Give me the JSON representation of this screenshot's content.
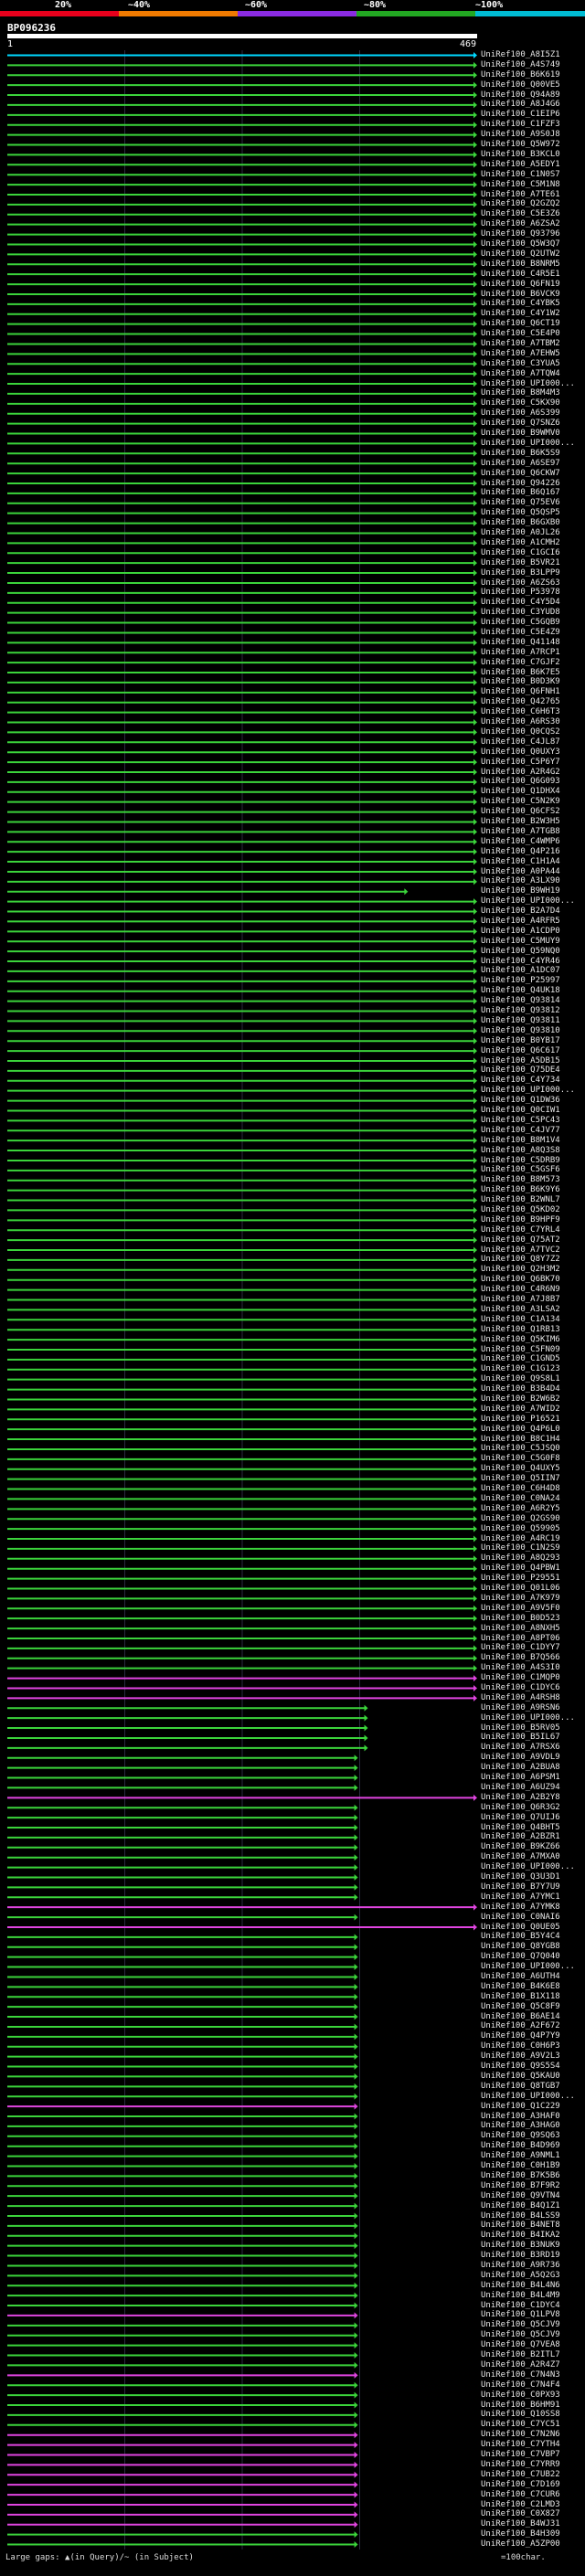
{
  "query": {
    "name": "BP096236",
    "coord_start": "1",
    "coord_end": "469",
    "length": 469
  },
  "scale": {
    "labels": [
      "20%",
      "~40%",
      "~60%",
      "~80%",
      "~100%"
    ],
    "colors": [
      "#e8001c",
      "#f07a00",
      "#8a2be2",
      "#22a722",
      "#00bcd4"
    ]
  },
  "footer": {
    "text": "Large gaps: ▲(in Query)/~ (in Subject)",
    "legend": "=100char."
  },
  "chart_data": {
    "type": "alignment-overview",
    "x_range": [
      1,
      469
    ],
    "hits": [
      {
        "id": "UniRef100_A8I5Z1",
        "end": 469,
        "color": "cyan"
      },
      {
        "id": "UniRef100_A4S749",
        "end": 469
      },
      {
        "id": "UniRef100_B6K619",
        "end": 469
      },
      {
        "id": "UniRef100_Q00VE5",
        "end": 469
      },
      {
        "id": "UniRef100_Q94A89",
        "end": 469
      },
      {
        "id": "UniRef100_A8J4G6",
        "end": 469
      },
      {
        "id": "UniRef100_C1EIP6",
        "end": 469
      },
      {
        "id": "UniRef100_C1FZF3",
        "end": 469
      },
      {
        "id": "UniRef100_A9S0J8",
        "end": 469
      },
      {
        "id": "UniRef100_Q5W972",
        "end": 469
      },
      {
        "id": "UniRef100_B3KCL0",
        "end": 469
      },
      {
        "id": "UniRef100_A5EDY1",
        "end": 469
      },
      {
        "id": "UniRef100_C1N0S7",
        "end": 469
      },
      {
        "id": "UniRef100_C5M1N8",
        "end": 469
      },
      {
        "id": "UniRef100_A7TE61",
        "end": 469
      },
      {
        "id": "UniRef100_Q2GZQ2",
        "end": 469
      },
      {
        "id": "UniRef100_C5E3Z6",
        "end": 469
      },
      {
        "id": "UniRef100_A6ZSA2",
        "end": 469
      },
      {
        "id": "UniRef100_Q93796",
        "end": 469
      },
      {
        "id": "UniRef100_Q5W3Q7",
        "end": 469
      },
      {
        "id": "UniRef100_Q2UTW2",
        "end": 469
      },
      {
        "id": "UniRef100_B8NRM5",
        "end": 469
      },
      {
        "id": "UniRef100_C4R5E1",
        "end": 469
      },
      {
        "id": "UniRef100_Q6FN19",
        "end": 469
      },
      {
        "id": "UniRef100_B6VCK9",
        "end": 469
      },
      {
        "id": "UniRef100_C4YBK5",
        "end": 469
      },
      {
        "id": "UniRef100_C4Y1W2",
        "end": 469
      },
      {
        "id": "UniRef100_Q6CT19",
        "end": 469
      },
      {
        "id": "UniRef100_C5E4P0",
        "end": 469
      },
      {
        "id": "UniRef100_A7TBM2",
        "end": 469
      },
      {
        "id": "UniRef100_A7EHW5",
        "end": 469
      },
      {
        "id": "UniRef100_C3YUA5",
        "end": 469
      },
      {
        "id": "UniRef100_A7TQW4",
        "end": 469
      },
      {
        "id": "UniRef100_UPI000...",
        "end": 469
      },
      {
        "id": "UniRef100_B8M4M3",
        "end": 469
      },
      {
        "id": "UniRef100_C5KX90",
        "end": 469
      },
      {
        "id": "UniRef100_A6S399",
        "end": 469
      },
      {
        "id": "UniRef100_Q7SNZ6",
        "end": 469
      },
      {
        "id": "UniRef100_B9WMV0",
        "end": 469
      },
      {
        "id": "UniRef100_UPI000...",
        "end": 469
      },
      {
        "id": "UniRef100_B6K5S9",
        "end": 469
      },
      {
        "id": "UniRef100_A6SE97",
        "end": 469
      },
      {
        "id": "UniRef100_Q6CKW7",
        "end": 469
      },
      {
        "id": "UniRef100_Q94226",
        "end": 469
      },
      {
        "id": "UniRef100_B6Q167",
        "end": 469
      },
      {
        "id": "UniRef100_Q75EV6",
        "end": 469
      },
      {
        "id": "UniRef100_Q5QSP5",
        "end": 469
      },
      {
        "id": "UniRef100_B6GXB0",
        "end": 469
      },
      {
        "id": "UniRef100_A0JL26",
        "end": 469
      },
      {
        "id": "UniRef100_A1CMH2",
        "end": 469
      },
      {
        "id": "UniRef100_C1GCI6",
        "end": 469
      },
      {
        "id": "UniRef100_B5VR21",
        "end": 469
      },
      {
        "id": "UniRef100_B3LPP9",
        "end": 469
      },
      {
        "id": "UniRef100_A6ZS63",
        "end": 469
      },
      {
        "id": "UniRef100_P53978",
        "end": 469
      },
      {
        "id": "UniRef100_C4Y5D4",
        "end": 469
      },
      {
        "id": "UniRef100_C3YUD8",
        "end": 469
      },
      {
        "id": "UniRef100_C5GQB9",
        "end": 469
      },
      {
        "id": "UniRef100_C5E4Z9",
        "end": 469
      },
      {
        "id": "UniRef100_Q41148",
        "end": 469
      },
      {
        "id": "UniRef100_A7RCP1",
        "end": 469
      },
      {
        "id": "UniRef100_C7GJF2",
        "end": 469
      },
      {
        "id": "UniRef100_B6K7E5",
        "end": 469
      },
      {
        "id": "UniRef100_B0D3K9",
        "end": 469
      },
      {
        "id": "UniRef100_Q6FNH1",
        "end": 469
      },
      {
        "id": "UniRef100_Q42765",
        "end": 469
      },
      {
        "id": "UniRef100_C6H6T3",
        "end": 469
      },
      {
        "id": "UniRef100_A6RS30",
        "end": 469
      },
      {
        "id": "UniRef100_Q0CQS2",
        "end": 469
      },
      {
        "id": "UniRef100_C4JL87",
        "end": 469
      },
      {
        "id": "UniRef100_Q0UXY3",
        "end": 469
      },
      {
        "id": "UniRef100_C5P6Y7",
        "end": 469
      },
      {
        "id": "UniRef100_A2R4G2",
        "end": 469
      },
      {
        "id": "UniRef100_Q6G093",
        "end": 469
      },
      {
        "id": "UniRef100_Q1DHX4",
        "end": 469
      },
      {
        "id": "UniRef100_C5N2K9",
        "end": 469
      },
      {
        "id": "UniRef100_Q6CFS2",
        "end": 469
      },
      {
        "id": "UniRef100_B2W3H5",
        "end": 469
      },
      {
        "id": "UniRef100_A7TGB8",
        "end": 469
      },
      {
        "id": "UniRef100_C4WMP6",
        "end": 469
      },
      {
        "id": "UniRef100_Q4P216",
        "end": 469
      },
      {
        "id": "UniRef100_C1H1A4",
        "end": 469
      },
      {
        "id": "UniRef100_A0PA44",
        "end": 469
      },
      {
        "id": "UniRef100_A3LX90",
        "end": 469
      },
      {
        "id": "UniRef100_B9WH19",
        "end": 400
      },
      {
        "id": "UniRef100_UPI000...",
        "end": 469
      },
      {
        "id": "UniRef100_B2A7D4",
        "end": 469
      },
      {
        "id": "UniRef100_A4RFR5",
        "end": 469
      },
      {
        "id": "UniRef100_A1CDP0",
        "end": 469
      },
      {
        "id": "UniRef100_C5MUY9",
        "end": 469
      },
      {
        "id": "UniRef100_Q59NQ0",
        "end": 469
      },
      {
        "id": "UniRef100_C4YR46",
        "end": 469
      },
      {
        "id": "UniRef100_A1DC07",
        "end": 469
      },
      {
        "id": "UniRef100_P25997",
        "end": 469
      },
      {
        "id": "UniRef100_Q4UK18",
        "end": 469
      },
      {
        "id": "UniRef100_Q93814",
        "end": 469
      },
      {
        "id": "UniRef100_Q93812",
        "end": 469
      },
      {
        "id": "UniRef100_Q93811",
        "end": 469
      },
      {
        "id": "UniRef100_Q93810",
        "end": 469
      },
      {
        "id": "UniRef100_B0YB17",
        "end": 469
      },
      {
        "id": "UniRef100_Q6C617",
        "end": 469
      },
      {
        "id": "UniRef100_A5DB15",
        "end": 469
      },
      {
        "id": "UniRef100_Q75DE4",
        "end": 469
      },
      {
        "id": "UniRef100_C4Y734",
        "end": 469
      },
      {
        "id": "UniRef100_UPI000...",
        "end": 469
      },
      {
        "id": "UniRef100_Q1DW36",
        "end": 469
      },
      {
        "id": "UniRef100_Q0CIW1",
        "end": 469
      },
      {
        "id": "UniRef100_C5PC43",
        "end": 469
      },
      {
        "id": "UniRef100_C4JV77",
        "end": 469
      },
      {
        "id": "UniRef100_B8M1V4",
        "end": 469
      },
      {
        "id": "UniRef100_A8Q3S8",
        "end": 469
      },
      {
        "id": "UniRef100_C5DRB9",
        "end": 469
      },
      {
        "id": "UniRef100_C5GSF6",
        "end": 469
      },
      {
        "id": "UniRef100_B8M573",
        "end": 469
      },
      {
        "id": "UniRef100_B6K9Y6",
        "end": 469
      },
      {
        "id": "UniRef100_B2WNL7",
        "end": 469
      },
      {
        "id": "UniRef100_Q5KD02",
        "end": 469
      },
      {
        "id": "UniRef100_B9HPF9",
        "end": 469
      },
      {
        "id": "UniRef100_C7YRL4",
        "end": 469
      },
      {
        "id": "UniRef100_Q75AT2",
        "end": 469
      },
      {
        "id": "UniRef100_A7TVC2",
        "end": 469
      },
      {
        "id": "UniRef100_Q8Y7Z2",
        "end": 469
      },
      {
        "id": "UniRef100_Q2H3M2",
        "end": 469
      },
      {
        "id": "UniRef100_Q6BK70",
        "end": 469
      },
      {
        "id": "UniRef100_C4R6N9",
        "end": 469
      },
      {
        "id": "UniRef100_A7J8B7",
        "end": 469
      },
      {
        "id": "UniRef100_A3LSA2",
        "end": 469
      },
      {
        "id": "UniRef100_C1A134",
        "end": 469
      },
      {
        "id": "UniRef100_Q1RB13",
        "end": 469
      },
      {
        "id": "UniRef100_Q5KIM6",
        "end": 469
      },
      {
        "id": "UniRef100_C5FN09",
        "end": 469
      },
      {
        "id": "UniRef100_C1GND5",
        "end": 469
      },
      {
        "id": "UniRef100_C1G123",
        "end": 469
      },
      {
        "id": "UniRef100_Q9S8L1",
        "end": 469
      },
      {
        "id": "UniRef100_B3B4D4",
        "end": 469
      },
      {
        "id": "UniRef100_B2W6B2",
        "end": 469
      },
      {
        "id": "UniRef100_A7WID2",
        "end": 469
      },
      {
        "id": "UniRef100_P16521",
        "end": 469
      },
      {
        "id": "UniRef100_Q4P6L0",
        "end": 469
      },
      {
        "id": "UniRef100_B8C1H4",
        "end": 469
      },
      {
        "id": "UniRef100_C5JSQ0",
        "end": 469
      },
      {
        "id": "UniRef100_C5G0F8",
        "end": 469
      },
      {
        "id": "UniRef100_Q4UXY5",
        "end": 469
      },
      {
        "id": "UniRef100_Q5IIN7",
        "end": 469
      },
      {
        "id": "UniRef100_C6H4D8",
        "end": 469
      },
      {
        "id": "UniRef100_C0NA24",
        "end": 469
      },
      {
        "id": "UniRef100_A6R2Y5",
        "end": 469
      },
      {
        "id": "UniRef100_Q2GS90",
        "end": 469
      },
      {
        "id": "UniRef100_Q59905",
        "end": 469
      },
      {
        "id": "UniRef100_A4RC19",
        "end": 469
      },
      {
        "id": "UniRef100_C1N2S9",
        "end": 469
      },
      {
        "id": "UniRef100_A8Q293",
        "end": 469
      },
      {
        "id": "UniRef100_Q4PBW1",
        "end": 469
      },
      {
        "id": "UniRef100_P29551",
        "end": 469
      },
      {
        "id": "UniRef100_Q01L06",
        "end": 469
      },
      {
        "id": "UniRef100_A7K979",
        "end": 469
      },
      {
        "id": "UniRef100_A9V5F0",
        "end": 469
      },
      {
        "id": "UniRef100_B0D523",
        "end": 469
      },
      {
        "id": "UniRef100_A8NXH5",
        "end": 469
      },
      {
        "id": "UniRef100_A8PT06",
        "end": 469
      },
      {
        "id": "UniRef100_C1DYY7",
        "end": 469
      },
      {
        "id": "UniRef100_B7Q566",
        "end": 469
      },
      {
        "id": "UniRef100_A4S3I0",
        "end": 469
      },
      {
        "id": "UniRef100_C1MQP0",
        "end": 469,
        "color": "magenta"
      },
      {
        "id": "UniRef100_C1DYC6",
        "end": 469,
        "color": "magenta"
      },
      {
        "id": "UniRef100_A4RSH8",
        "end": 469,
        "color": "magenta"
      },
      {
        "id": "UniRef100_A9RSN6",
        "end": 360
      },
      {
        "id": "UniRef100_UPI000...",
        "end": 360
      },
      {
        "id": "UniRef100_B5RV05",
        "end": 360
      },
      {
        "id": "UniRef100_B5IL67",
        "end": 360
      },
      {
        "id": "UniRef100_A7RSX6",
        "end": 360
      },
      {
        "id": "UniRef100_A9VDL9",
        "end": 350
      },
      {
        "id": "UniRef100_A2BUA8",
        "end": 350
      },
      {
        "id": "UniRef100_A6PSM1",
        "end": 350
      },
      {
        "id": "UniRef100_A6UZ94",
        "end": 350
      },
      {
        "id": "UniRef100_A2B2Y8",
        "end": 469,
        "color": "magenta"
      },
      {
        "id": "UniRef100_Q6R3G2",
        "end": 350
      },
      {
        "id": "UniRef100_Q7UIJ6",
        "end": 350
      },
      {
        "id": "UniRef100_Q4BHT5",
        "end": 350
      },
      {
        "id": "UniRef100_A2BZR1",
        "end": 350
      },
      {
        "id": "UniRef100_B9KZ66",
        "end": 350
      },
      {
        "id": "UniRef100_A7MXA0",
        "end": 350
      },
      {
        "id": "UniRef100_UPI000...",
        "end": 350
      },
      {
        "id": "UniRef100_Q3U3D1",
        "end": 350
      },
      {
        "id": "UniRef100_B7Y7U9",
        "end": 350
      },
      {
        "id": "UniRef100_A7YMC1",
        "end": 350
      },
      {
        "id": "UniRef100_A7YMK8",
        "end": 469,
        "color": "magenta"
      },
      {
        "id": "UniRef100_C0NAI6",
        "end": 350
      },
      {
        "id": "UniRef100_Q0UE05",
        "end": 469,
        "color": "magenta"
      },
      {
        "id": "UniRef100_B5Y4C4",
        "end": 350
      },
      {
        "id": "UniRef100_Q8YGB8",
        "end": 350
      },
      {
        "id": "UniRef100_Q7Q040",
        "end": 350
      },
      {
        "id": "UniRef100_UPI000...",
        "end": 350
      },
      {
        "id": "UniRef100_A6UTH4",
        "end": 350
      },
      {
        "id": "UniRef100_B4K6E8",
        "end": 350
      },
      {
        "id": "UniRef100_B1X118",
        "end": 350
      },
      {
        "id": "UniRef100_Q5C8F9",
        "end": 350
      },
      {
        "id": "UniRef100_B6AE14",
        "end": 350
      },
      {
        "id": "UniRef100_A2F672",
        "end": 350
      },
      {
        "id": "UniRef100_Q4P7Y9",
        "end": 350
      },
      {
        "id": "UniRef100_C0H6P3",
        "end": 350
      },
      {
        "id": "UniRef100_A9V2L3",
        "end": 350
      },
      {
        "id": "UniRef100_Q9S5S4",
        "end": 350
      },
      {
        "id": "UniRef100_Q5KAU0",
        "end": 350
      },
      {
        "id": "UniRef100_Q8TGB7",
        "end": 350
      },
      {
        "id": "UniRef100_UPI000...",
        "end": 350
      },
      {
        "id": "UniRef100_Q1C229",
        "end": 350,
        "color": "magenta"
      },
      {
        "id": "UniRef100_A3HAF0",
        "end": 350
      },
      {
        "id": "UniRef100_A3HAG0",
        "end": 350
      },
      {
        "id": "UniRef100_Q9SQ63",
        "end": 350
      },
      {
        "id": "UniRef100_B4D969",
        "end": 350
      },
      {
        "id": "UniRef100_A9NML1",
        "end": 350
      },
      {
        "id": "UniRef100_C0H1B9",
        "end": 350
      },
      {
        "id": "UniRef100_B7K5B6",
        "end": 350
      },
      {
        "id": "UniRef100_B7F9R2",
        "end": 350
      },
      {
        "id": "UniRef100_Q9VTN4",
        "end": 350
      },
      {
        "id": "UniRef100_B4Q1Z1",
        "end": 350
      },
      {
        "id": "UniRef100_B4LSS9",
        "end": 350
      },
      {
        "id": "UniRef100_B4NET8",
        "end": 350
      },
      {
        "id": "UniRef100_B4IKA2",
        "end": 350
      },
      {
        "id": "UniRef100_B3NUK9",
        "end": 350
      },
      {
        "id": "UniRef100_B3RD19",
        "end": 350
      },
      {
        "id": "UniRef100_A9R736",
        "end": 350
      },
      {
        "id": "UniRef100_A5Q2G3",
        "end": 350
      },
      {
        "id": "UniRef100_B4L4N6",
        "end": 350
      },
      {
        "id": "UniRef100_B4L4M9",
        "end": 350
      },
      {
        "id": "UniRef100_C1DYC4",
        "end": 350
      },
      {
        "id": "UniRef100_Q1LPV8",
        "end": 350,
        "color": "magenta"
      },
      {
        "id": "UniRef100_Q5CJV9",
        "end": 350
      },
      {
        "id": "UniRef100_Q5CJV9",
        "end": 350
      },
      {
        "id": "UniRef100_Q7VEA8",
        "end": 350
      },
      {
        "id": "UniRef100_B2ITL7",
        "end": 350
      },
      {
        "id": "UniRef100_A2R4Z7",
        "end": 350
      },
      {
        "id": "UniRef100_C7N4N3",
        "end": 350,
        "color": "magenta"
      },
      {
        "id": "UniRef100_C7N4F4",
        "end": 350
      },
      {
        "id": "UniRef100_C0PX93",
        "end": 350
      },
      {
        "id": "UniRef100_B6HM91",
        "end": 350
      },
      {
        "id": "UniRef100_Q10SS8",
        "end": 350
      },
      {
        "id": "UniRef100_C7YC51",
        "end": 350
      },
      {
        "id": "UniRef100_C7N2N6",
        "end": 350,
        "color": "magenta"
      },
      {
        "id": "UniRef100_C7YTH4",
        "end": 350,
        "color": "magenta"
      },
      {
        "id": "UniRef100_C7VBP7",
        "end": 350,
        "color": "magenta"
      },
      {
        "id": "UniRef100_C7YRR9",
        "end": 350,
        "color": "magenta"
      },
      {
        "id": "UniRef100_C7UB22",
        "end": 350,
        "color": "magenta"
      },
      {
        "id": "UniRef100_C7D169",
        "end": 350,
        "color": "magenta"
      },
      {
        "id": "UniRef100_C7CUR6",
        "end": 350,
        "color": "magenta"
      },
      {
        "id": "UniRef100_C2LMD3",
        "end": 350,
        "color": "magenta"
      },
      {
        "id": "UniRef100_C0X827",
        "end": 350,
        "color": "magenta"
      },
      {
        "id": "UniRef100_B4WJ31",
        "end": 350,
        "color": "magenta"
      },
      {
        "id": "UniRef100_B4H309",
        "end": 350
      },
      {
        "id": "UniRef100_A5ZP00",
        "end": 350
      }
    ]
  }
}
